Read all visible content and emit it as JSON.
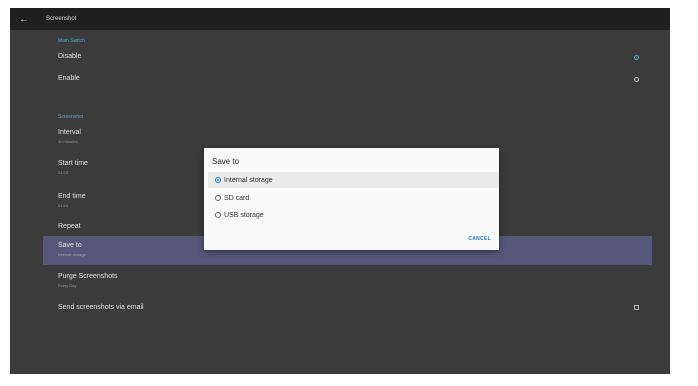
{
  "appbar": {
    "back_icon": "←",
    "title": "Screenshot"
  },
  "main_switch": {
    "category": "Main Switch",
    "disable_label": "Disable",
    "enable_label": "Enable"
  },
  "screenshot": {
    "category": "Screenshot",
    "interval": {
      "title": "Interval",
      "value": "30 minutes"
    },
    "start_time": {
      "title": "Start time",
      "value": "01:23"
    },
    "end_time": {
      "title": "End time",
      "value": "01:24"
    },
    "repeat": {
      "title": "Repeat"
    },
    "save_to": {
      "title": "Save to",
      "value": "Internal storage"
    },
    "purge": {
      "title": "Purge Screenshots",
      "value": "Every Day"
    },
    "send_email": {
      "title": "Send screenshots via email"
    }
  },
  "dialog": {
    "title": "Save to",
    "options": [
      "Internal storage",
      "SD card",
      "USB storage"
    ],
    "selected": "Internal storage",
    "cancel_label": "CANCEL"
  },
  "colors": {
    "accent": "#5aa9c9",
    "highlight": "#56587a",
    "dialog_accent": "#1976d2"
  }
}
